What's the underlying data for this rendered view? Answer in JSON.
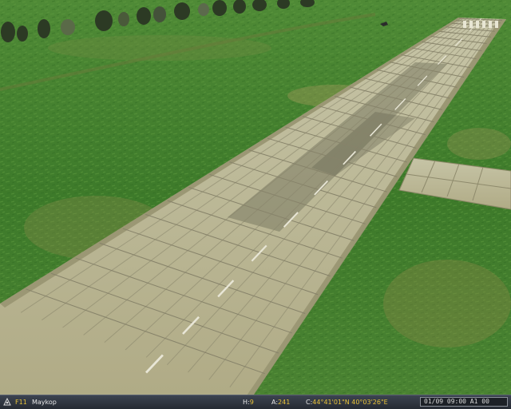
{
  "status_bar": {
    "view_key": "F11",
    "location": "Maykop",
    "heading_label": "H:",
    "heading_value": "9",
    "altitude_label": "A:",
    "altitude_value": "241",
    "coords_label": "C:",
    "coords_value": "44°41'01\"N 40°03'26\"E",
    "clock": "01/09 09:00 A1 00"
  },
  "colors": {
    "grass": "#3f7a2c",
    "runway": "#b4b08c",
    "status_bg": "#2e343d",
    "accent": "#e8c23a"
  }
}
